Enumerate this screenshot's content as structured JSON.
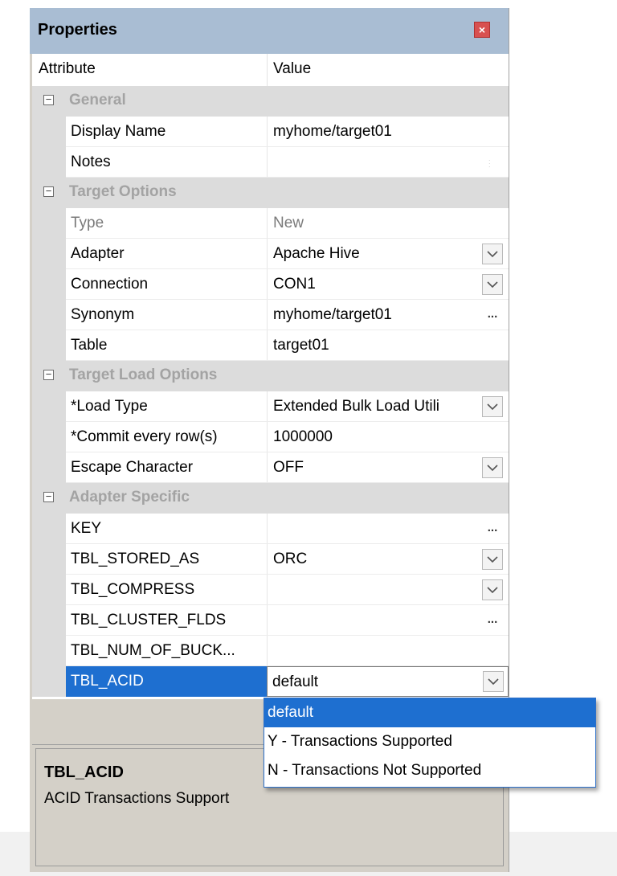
{
  "panel": {
    "title": "Properties"
  },
  "header": {
    "attribute": "Attribute",
    "value": "Value"
  },
  "rows": [
    {
      "kind": "category",
      "label": "General"
    },
    {
      "kind": "prop",
      "attr": "Display Name",
      "value": "myhome/target01",
      "control": "none"
    },
    {
      "kind": "prop",
      "attr": "Notes",
      "value": "",
      "control": "notes"
    },
    {
      "kind": "category",
      "label": "Target Options"
    },
    {
      "kind": "prop",
      "attr": "Type",
      "value": "New",
      "control": "none",
      "disabled": true
    },
    {
      "kind": "prop",
      "attr": "Adapter",
      "value": "Apache Hive",
      "control": "dropdown"
    },
    {
      "kind": "prop",
      "attr": "Connection",
      "value": "CON1",
      "control": "dropdown"
    },
    {
      "kind": "prop",
      "attr": "Synonym",
      "value": "myhome/target01",
      "control": "ellipsis"
    },
    {
      "kind": "prop",
      "attr": "Table",
      "value": "target01",
      "control": "none"
    },
    {
      "kind": "category",
      "label": "Target Load Options"
    },
    {
      "kind": "prop",
      "attr": "*Load Type",
      "value": "Extended Bulk Load Utili",
      "control": "dropdown"
    },
    {
      "kind": "prop",
      "attr": "*Commit every row(s)",
      "value": "1000000",
      "control": "none"
    },
    {
      "kind": "prop",
      "attr": "Escape Character",
      "value": "OFF",
      "control": "dropdown"
    },
    {
      "kind": "category",
      "label": "Adapter Specific"
    },
    {
      "kind": "prop",
      "attr": "KEY",
      "value": "",
      "control": "ellipsis"
    },
    {
      "kind": "prop",
      "attr": "TBL_STORED_AS",
      "value": "ORC",
      "control": "dropdown"
    },
    {
      "kind": "prop",
      "attr": "TBL_COMPRESS",
      "value": "",
      "control": "dropdown"
    },
    {
      "kind": "prop",
      "attr": "TBL_CLUSTER_FLDS",
      "value": "",
      "control": "ellipsis"
    },
    {
      "kind": "prop",
      "attr": "TBL_NUM_OF_BUCK...",
      "value": "",
      "control": "none"
    },
    {
      "kind": "selected",
      "attr": "TBL_ACID",
      "value": "default",
      "control": "dropdown"
    }
  ],
  "ellipsis_glyph": "...",
  "dropdown": {
    "options": [
      "default",
      "Y - Transactions Supported",
      "N - Transactions Not Supported"
    ],
    "selected_index": 0
  },
  "description": {
    "title": "TBL_ACID",
    "text": "ACID Transactions Support"
  },
  "colors": {
    "selection": "#1e6fd0",
    "titlebar": "#a9bdd3",
    "close": "#d85050"
  }
}
